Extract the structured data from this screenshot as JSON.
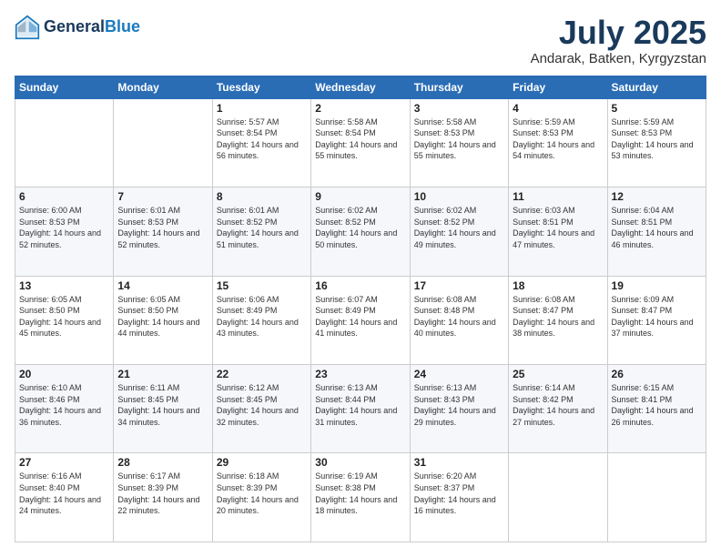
{
  "header": {
    "logo_line1": "General",
    "logo_line2": "Blue",
    "title": "July 2025",
    "subtitle": "Andarak, Batken, Kyrgyzstan"
  },
  "weekdays": [
    "Sunday",
    "Monday",
    "Tuesday",
    "Wednesday",
    "Thursday",
    "Friday",
    "Saturday"
  ],
  "weeks": [
    [
      null,
      null,
      {
        "day": 1,
        "sunrise": "5:57 AM",
        "sunset": "8:54 PM",
        "daylight": "14 hours and 56 minutes."
      },
      {
        "day": 2,
        "sunrise": "5:58 AM",
        "sunset": "8:54 PM",
        "daylight": "14 hours and 55 minutes."
      },
      {
        "day": 3,
        "sunrise": "5:58 AM",
        "sunset": "8:53 PM",
        "daylight": "14 hours and 55 minutes."
      },
      {
        "day": 4,
        "sunrise": "5:59 AM",
        "sunset": "8:53 PM",
        "daylight": "14 hours and 54 minutes."
      },
      {
        "day": 5,
        "sunrise": "5:59 AM",
        "sunset": "8:53 PM",
        "daylight": "14 hours and 53 minutes."
      }
    ],
    [
      {
        "day": 6,
        "sunrise": "6:00 AM",
        "sunset": "8:53 PM",
        "daylight": "14 hours and 52 minutes."
      },
      {
        "day": 7,
        "sunrise": "6:01 AM",
        "sunset": "8:53 PM",
        "daylight": "14 hours and 52 minutes."
      },
      {
        "day": 8,
        "sunrise": "6:01 AM",
        "sunset": "8:52 PM",
        "daylight": "14 hours and 51 minutes."
      },
      {
        "day": 9,
        "sunrise": "6:02 AM",
        "sunset": "8:52 PM",
        "daylight": "14 hours and 50 minutes."
      },
      {
        "day": 10,
        "sunrise": "6:02 AM",
        "sunset": "8:52 PM",
        "daylight": "14 hours and 49 minutes."
      },
      {
        "day": 11,
        "sunrise": "6:03 AM",
        "sunset": "8:51 PM",
        "daylight": "14 hours and 47 minutes."
      },
      {
        "day": 12,
        "sunrise": "6:04 AM",
        "sunset": "8:51 PM",
        "daylight": "14 hours and 46 minutes."
      }
    ],
    [
      {
        "day": 13,
        "sunrise": "6:05 AM",
        "sunset": "8:50 PM",
        "daylight": "14 hours and 45 minutes."
      },
      {
        "day": 14,
        "sunrise": "6:05 AM",
        "sunset": "8:50 PM",
        "daylight": "14 hours and 44 minutes."
      },
      {
        "day": 15,
        "sunrise": "6:06 AM",
        "sunset": "8:49 PM",
        "daylight": "14 hours and 43 minutes."
      },
      {
        "day": 16,
        "sunrise": "6:07 AM",
        "sunset": "8:49 PM",
        "daylight": "14 hours and 41 minutes."
      },
      {
        "day": 17,
        "sunrise": "6:08 AM",
        "sunset": "8:48 PM",
        "daylight": "14 hours and 40 minutes."
      },
      {
        "day": 18,
        "sunrise": "6:08 AM",
        "sunset": "8:47 PM",
        "daylight": "14 hours and 38 minutes."
      },
      {
        "day": 19,
        "sunrise": "6:09 AM",
        "sunset": "8:47 PM",
        "daylight": "14 hours and 37 minutes."
      }
    ],
    [
      {
        "day": 20,
        "sunrise": "6:10 AM",
        "sunset": "8:46 PM",
        "daylight": "14 hours and 36 minutes."
      },
      {
        "day": 21,
        "sunrise": "6:11 AM",
        "sunset": "8:45 PM",
        "daylight": "14 hours and 34 minutes."
      },
      {
        "day": 22,
        "sunrise": "6:12 AM",
        "sunset": "8:45 PM",
        "daylight": "14 hours and 32 minutes."
      },
      {
        "day": 23,
        "sunrise": "6:13 AM",
        "sunset": "8:44 PM",
        "daylight": "14 hours and 31 minutes."
      },
      {
        "day": 24,
        "sunrise": "6:13 AM",
        "sunset": "8:43 PM",
        "daylight": "14 hours and 29 minutes."
      },
      {
        "day": 25,
        "sunrise": "6:14 AM",
        "sunset": "8:42 PM",
        "daylight": "14 hours and 27 minutes."
      },
      {
        "day": 26,
        "sunrise": "6:15 AM",
        "sunset": "8:41 PM",
        "daylight": "14 hours and 26 minutes."
      }
    ],
    [
      {
        "day": 27,
        "sunrise": "6:16 AM",
        "sunset": "8:40 PM",
        "daylight": "14 hours and 24 minutes."
      },
      {
        "day": 28,
        "sunrise": "6:17 AM",
        "sunset": "8:39 PM",
        "daylight": "14 hours and 22 minutes."
      },
      {
        "day": 29,
        "sunrise": "6:18 AM",
        "sunset": "8:39 PM",
        "daylight": "14 hours and 20 minutes."
      },
      {
        "day": 30,
        "sunrise": "6:19 AM",
        "sunset": "8:38 PM",
        "daylight": "14 hours and 18 minutes."
      },
      {
        "day": 31,
        "sunrise": "6:20 AM",
        "sunset": "8:37 PM",
        "daylight": "14 hours and 16 minutes."
      },
      null,
      null
    ]
  ]
}
